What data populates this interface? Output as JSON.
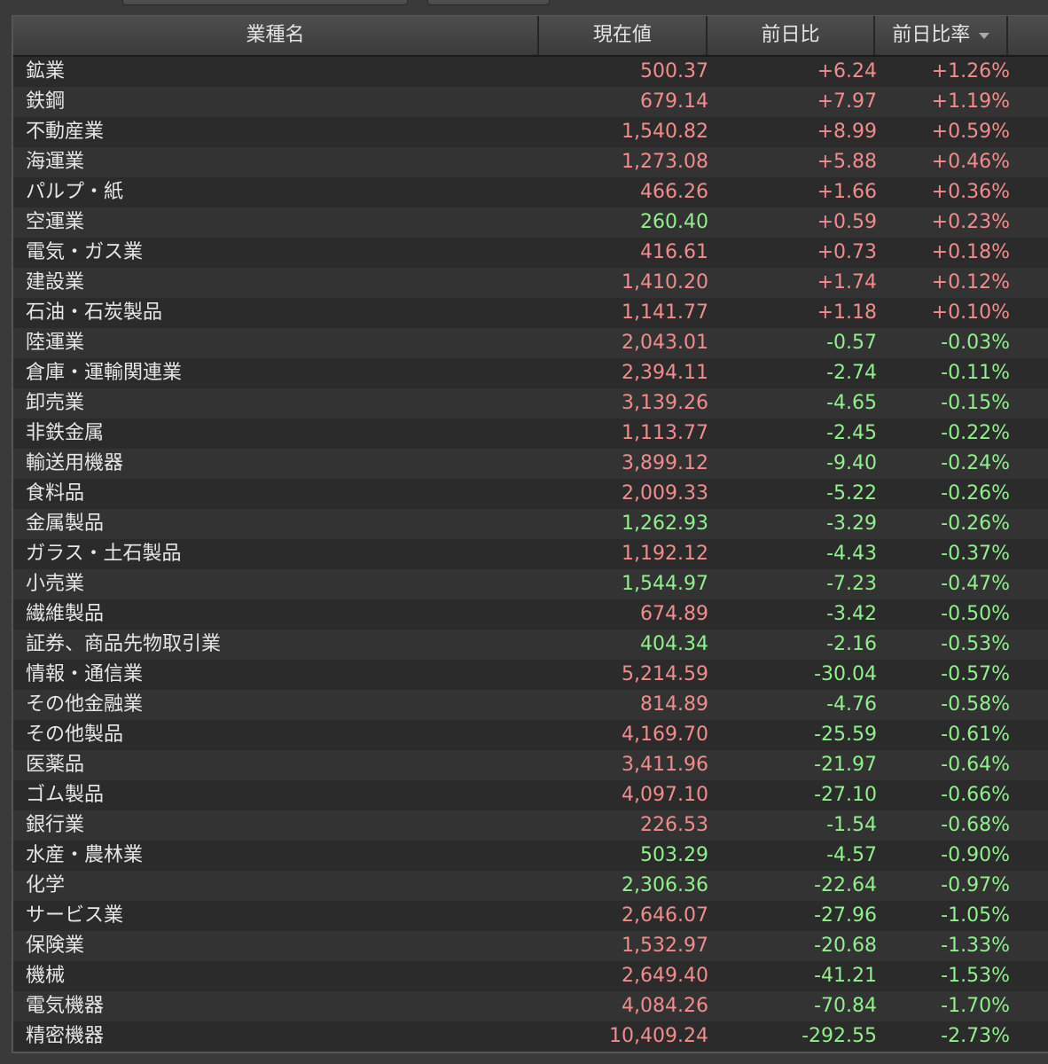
{
  "columns": {
    "name": "業種名",
    "price": "現在値",
    "change": "前日比",
    "rate": "前日比率"
  },
  "colors": {
    "up": "#f08c8c",
    "down": "#8ff08c",
    "text": "#e6e6e6"
  },
  "rows": [
    {
      "name": "鉱業",
      "price": "500.37",
      "price_dir": "up",
      "change": "+6.24",
      "rate": "+1.26%"
    },
    {
      "name": "鉄鋼",
      "price": "679.14",
      "price_dir": "up",
      "change": "+7.97",
      "rate": "+1.19%"
    },
    {
      "name": "不動産業",
      "price": "1,540.82",
      "price_dir": "up",
      "change": "+8.99",
      "rate": "+0.59%"
    },
    {
      "name": "海運業",
      "price": "1,273.08",
      "price_dir": "up",
      "change": "+5.88",
      "rate": "+0.46%"
    },
    {
      "name": "パルプ・紙",
      "price": "466.26",
      "price_dir": "up",
      "change": "+1.66",
      "rate": "+0.36%"
    },
    {
      "name": "空運業",
      "price": "260.40",
      "price_dir": "down",
      "change": "+0.59",
      "rate": "+0.23%"
    },
    {
      "name": "電気・ガス業",
      "price": "416.61",
      "price_dir": "up",
      "change": "+0.73",
      "rate": "+0.18%"
    },
    {
      "name": "建設業",
      "price": "1,410.20",
      "price_dir": "up",
      "change": "+1.74",
      "rate": "+0.12%"
    },
    {
      "name": "石油・石炭製品",
      "price": "1,141.77",
      "price_dir": "up",
      "change": "+1.18",
      "rate": "+0.10%"
    },
    {
      "name": "陸運業",
      "price": "2,043.01",
      "price_dir": "up",
      "change": "-0.57",
      "rate": "-0.03%"
    },
    {
      "name": "倉庫・運輸関連業",
      "price": "2,394.11",
      "price_dir": "up",
      "change": "-2.74",
      "rate": "-0.11%"
    },
    {
      "name": "卸売業",
      "price": "3,139.26",
      "price_dir": "up",
      "change": "-4.65",
      "rate": "-0.15%"
    },
    {
      "name": "非鉄金属",
      "price": "1,113.77",
      "price_dir": "up",
      "change": "-2.45",
      "rate": "-0.22%"
    },
    {
      "name": "輸送用機器",
      "price": "3,899.12",
      "price_dir": "up",
      "change": "-9.40",
      "rate": "-0.24%"
    },
    {
      "name": "食料品",
      "price": "2,009.33",
      "price_dir": "up",
      "change": "-5.22",
      "rate": "-0.26%"
    },
    {
      "name": "金属製品",
      "price": "1,262.93",
      "price_dir": "down",
      "change": "-3.29",
      "rate": "-0.26%"
    },
    {
      "name": "ガラス・土石製品",
      "price": "1,192.12",
      "price_dir": "up",
      "change": "-4.43",
      "rate": "-0.37%"
    },
    {
      "name": "小売業",
      "price": "1,544.97",
      "price_dir": "down",
      "change": "-7.23",
      "rate": "-0.47%"
    },
    {
      "name": "繊維製品",
      "price": "674.89",
      "price_dir": "up",
      "change": "-3.42",
      "rate": "-0.50%"
    },
    {
      "name": "証券、商品先物取引業",
      "price": "404.34",
      "price_dir": "down",
      "change": "-2.16",
      "rate": "-0.53%"
    },
    {
      "name": "情報・通信業",
      "price": "5,214.59",
      "price_dir": "up",
      "change": "-30.04",
      "rate": "-0.57%"
    },
    {
      "name": "その他金融業",
      "price": "814.89",
      "price_dir": "up",
      "change": "-4.76",
      "rate": "-0.58%"
    },
    {
      "name": "その他製品",
      "price": "4,169.70",
      "price_dir": "up",
      "change": "-25.59",
      "rate": "-0.61%"
    },
    {
      "name": "医薬品",
      "price": "3,411.96",
      "price_dir": "up",
      "change": "-21.97",
      "rate": "-0.64%"
    },
    {
      "name": "ゴム製品",
      "price": "4,097.10",
      "price_dir": "up",
      "change": "-27.10",
      "rate": "-0.66%"
    },
    {
      "name": "銀行業",
      "price": "226.53",
      "price_dir": "up",
      "change": "-1.54",
      "rate": "-0.68%"
    },
    {
      "name": "水産・農林業",
      "price": "503.29",
      "price_dir": "down",
      "change": "-4.57",
      "rate": "-0.90%"
    },
    {
      "name": "化学",
      "price": "2,306.36",
      "price_dir": "down",
      "change": "-22.64",
      "rate": "-0.97%"
    },
    {
      "name": "サービス業",
      "price": "2,646.07",
      "price_dir": "up",
      "change": "-27.96",
      "rate": "-1.05%"
    },
    {
      "name": "保険業",
      "price": "1,532.97",
      "price_dir": "up",
      "change": "-20.68",
      "rate": "-1.33%"
    },
    {
      "name": "機械",
      "price": "2,649.40",
      "price_dir": "up",
      "change": "-41.21",
      "rate": "-1.53%"
    },
    {
      "name": "電気機器",
      "price": "4,084.26",
      "price_dir": "up",
      "change": "-70.84",
      "rate": "-1.70%"
    },
    {
      "name": "精密機器",
      "price": "10,409.24",
      "price_dir": "up",
      "change": "-292.55",
      "rate": "-2.73%"
    }
  ]
}
